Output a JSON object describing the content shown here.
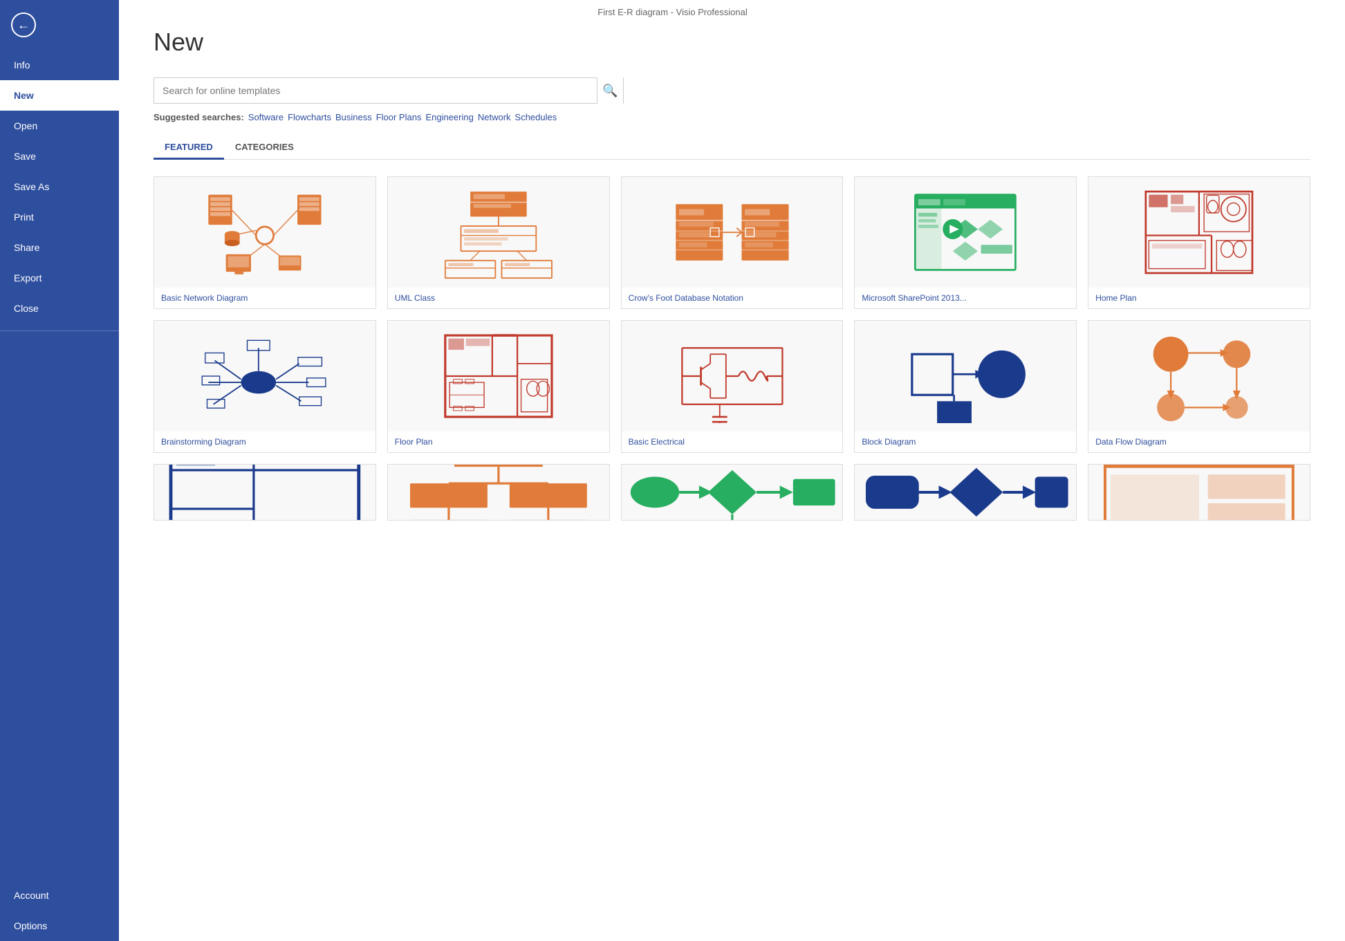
{
  "window": {
    "title": "First E-R diagram - Visio Professional"
  },
  "sidebar": {
    "back_label": "←",
    "items": [
      {
        "id": "info",
        "label": "Info",
        "active": false
      },
      {
        "id": "new",
        "label": "New",
        "active": true
      },
      {
        "id": "open",
        "label": "Open",
        "active": false
      },
      {
        "id": "save",
        "label": "Save",
        "active": false
      },
      {
        "id": "saveas",
        "label": "Save As",
        "active": false
      },
      {
        "id": "print",
        "label": "Print",
        "active": false
      },
      {
        "id": "share",
        "label": "Share",
        "active": false
      },
      {
        "id": "export",
        "label": "Export",
        "active": false
      },
      {
        "id": "close",
        "label": "Close",
        "active": false
      }
    ],
    "bottom_items": [
      {
        "id": "account",
        "label": "Account"
      },
      {
        "id": "options",
        "label": "Options"
      }
    ]
  },
  "main": {
    "title": "New",
    "search": {
      "placeholder": "Search for online templates"
    },
    "suggested": {
      "label": "Suggested searches:",
      "links": [
        "Software",
        "Flowcharts",
        "Business",
        "Floor Plans",
        "Engineering",
        "Network",
        "Schedules"
      ]
    },
    "tabs": [
      {
        "id": "featured",
        "label": "FEATURED",
        "active": true
      },
      {
        "id": "categories",
        "label": "CATEGORIES",
        "active": false
      }
    ],
    "templates_row1": [
      {
        "id": "basic-network",
        "label": "Basic Network Diagram"
      },
      {
        "id": "uml-class",
        "label": "UML Class"
      },
      {
        "id": "crows-foot",
        "label": "Crow's Foot Database Notation"
      },
      {
        "id": "sharepoint",
        "label": "Microsoft SharePoint 2013..."
      },
      {
        "id": "home-plan",
        "label": "Home Plan"
      }
    ],
    "templates_row2": [
      {
        "id": "brainstorming",
        "label": "Brainstorming Diagram"
      },
      {
        "id": "floor-plan",
        "label": "Floor Plan"
      },
      {
        "id": "basic-electrical",
        "label": "Basic Electrical"
      },
      {
        "id": "block-diagram",
        "label": "Block Diagram"
      },
      {
        "id": "data-flow",
        "label": "Data Flow Diagram"
      }
    ],
    "templates_row3": [
      {
        "id": "t1",
        "label": ""
      },
      {
        "id": "t2",
        "label": ""
      },
      {
        "id": "t3",
        "label": ""
      },
      {
        "id": "t4",
        "label": ""
      },
      {
        "id": "t5",
        "label": ""
      }
    ]
  },
  "colors": {
    "accent": "#2E4E9E",
    "orange": "#E07B39",
    "red": "#C0392B",
    "green": "#27AE60",
    "blue": "#2980B9",
    "dark_blue": "#1A3A6E"
  }
}
